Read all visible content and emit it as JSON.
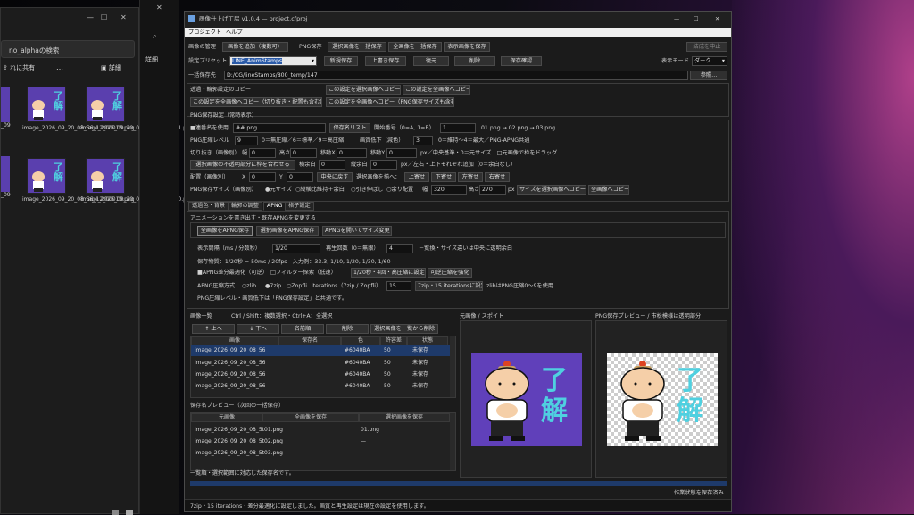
{
  "explorer": {
    "search_text": "no_alphaの検索",
    "share_label": "れに共有",
    "more_label": "…",
    "detail_label": "詳細",
    "side_label": "詳細",
    "thumbs": [
      {
        "cap": "image_2026_09_20_08_56_12_00010.png",
        "ryo": "了\n解"
      },
      {
        "cap": "image_2026_09_20_08_56_12_00011.png",
        "ryo": "了\n解"
      },
      {
        "cap": "image_2026_09_20_08_56_12_00019.png",
        "ryo": "了\n解"
      },
      {
        "cap": "image_2026_09_20_08_56_12_00020.png",
        "ryo": "了\n解"
      }
    ],
    "partial_caps": [
      "_09",
      "_56_12_0",
      "_09",
      "_56_12_0"
    ]
  },
  "app": {
    "title": "画像仕上げ工房 v1.0.4 — project.cfproj",
    "min": "—",
    "max": "☐",
    "close": "✕",
    "menu": [
      "プロジェクト",
      "ヘルプ"
    ],
    "toolbar": {
      "manage": "画像の管理",
      "add": "画像を追加（複数可）",
      "png_save": "PNG保存",
      "save_selected": "選択画像を一括保存",
      "save_all": "全画像を一括保存",
      "save_shown": "表示画像を保存",
      "stop": "結成を中止"
    },
    "preset": {
      "label": "設定プリセット",
      "value": "LINE_AnimStamps",
      "new": "新規保存",
      "overwrite": "上書き保存",
      "restore": "復元",
      "delete": "削除",
      "check": "保存確認",
      "mode_label": "表示モード",
      "mode_value": "ダーク"
    },
    "dest": {
      "label": "一括保存先",
      "value": "D:/CG/lineStamps/800_temp/147",
      "browse": "参照…"
    },
    "copy": {
      "label": "透過・輪郭設定のコピー",
      "to_selected": "この設定を選択画像へコピー",
      "to_all": "この設定を全画像へコピー",
      "copy_all_size": "この設定を全画像へコピー（切り抜き・配置も含む）",
      "copy_all_png": "この設定を全画像へコピー（PNG保存サイズも含む）"
    },
    "png": {
      "group": "PNG保存設定（常時表示）",
      "serial": "■連番名を使用",
      "serial_val": "##.png",
      "save_list": "保存名リスト",
      "start_label": "開始番号（0=A, 1=B）",
      "start_val": "1",
      "example": "01.png → 02.png → 03.png",
      "comp_label": "PNG圧縮レベル",
      "comp_val": "9",
      "comp_desc": "0＝無圧縮／6＝標準／9＝高圧縮",
      "reduce_label": "画質低下（減色）",
      "reduce_val": "3",
      "reduce_desc": "0＝維持～4＝最大／PNG-APNG共通",
      "crop_label": "切り抜き（画像別）",
      "w_label": "幅",
      "w_val": "0",
      "h_label": "高さ",
      "h_val": "0",
      "mx_label": "移動X",
      "mx_val": "0",
      "my_label": "移動Y",
      "my_val": "0",
      "crop_desc": "px／中央基準・0＝元サイズ　□元画像で枠をドラッグ",
      "fit_btn": "選択画像の不透明部分に枠を合わせる",
      "margin_label": "横余白",
      "margin_val": "0",
      "vmargin_label": "縦余白",
      "vmargin_val": "0",
      "margin_desc": "px／左右・上下それぞれ追加（0＝余白なし）",
      "place_label": "配置（画像別）",
      "x_label": "X",
      "x_val": "0",
      "y_label": "Y",
      "y_val": "0",
      "center_btn": "中央に戻す",
      "place_to": "選択画像を揃へ：",
      "up": "上寄せ",
      "down": "下寄せ",
      "left": "左寄せ",
      "right": "右寄せ",
      "size_label": "PNG保存サイズ（画像別）",
      "orig": "●元サイズ",
      "fit": "○縦横比維持＋余白",
      "stretch": "○引き伸ばし",
      "fixed": "○余り配置",
      "wl": "幅",
      "wv": "320",
      "hl": "高さ",
      "hv": "270",
      "px": "px",
      "size_to_sel": "サイズを選択画像へコピー",
      "to_all": "全画像へコピー"
    },
    "tabs": [
      "透過色・背景",
      "輪郭の調整",
      "APNG",
      "格子設定"
    ],
    "apng": {
      "header": "アニメーションを書き出す・既存APNGを変更する",
      "save_all": "全画像をAPNG保存",
      "save_sel": "選択画像をAPNG保存",
      "open": "APNGを開いてサイズ変更",
      "interval_label": "表示間隔（ms / 分数秒）",
      "interval_val": "1/20",
      "loop_label": "再生回数（0＝無限）",
      "loop_val": "4",
      "loop_desc": "－覧換・サイズ違いは中央に透明余白",
      "info1": "保存物質：1/20秒 = 50ms / 20fps　入力例：33.3, 1/10, 1/20, 1/30, 1/60",
      "opt": "■APNG差分最適化（可逆）　□フィルター探索（低速）",
      "opt_btn": "1/20秒・4回・高圧縮に設定",
      "opt_btn2": "可逆圧縮を強化",
      "method_label": "APNG圧縮方式",
      "m1": "○zlib",
      "m2": "●7zip",
      "m3": "○Zopfli",
      "iter_label": "iterations（7zip / Zopfli）",
      "iter_val": "15",
      "iter_btn": "7zip・15 iterationsに設定",
      "iter_desc": "zlibはPNG圧縮0〜9を使用",
      "note": "PNG圧縮レベル・画質低下は「PNG保存設定」と共通です。"
    },
    "list": {
      "title": "画像一覧",
      "hint": "Ctrl / Shift：複数選択・Ctrl+A：全選択",
      "up": "↑ 上へ",
      "down": "↓ 下へ",
      "rename": "名前順",
      "remove": "削除",
      "remove_sel": "選択画像を一覧から削除",
      "cols": [
        "画像",
        "保存名",
        "色",
        "許容差",
        "状態"
      ],
      "rows": [
        {
          "img": "image_2026_09_20_08_56",
          "name": "",
          "color": "#6040BA",
          "tol": "50",
          "state": "未保存"
        },
        {
          "img": "image_2026_09_20_08_56",
          "name": "",
          "color": "#6040BA",
          "tol": "50",
          "state": "未保存"
        },
        {
          "img": "image_2026_09_20_08_56",
          "name": "",
          "color": "#6040BA",
          "tol": "50",
          "state": "未保存"
        },
        {
          "img": "image_2026_09_20_08_56",
          "name": "",
          "color": "#6040BA",
          "tol": "50",
          "state": "未保存"
        }
      ]
    },
    "savepv": {
      "title": "保存名プレビュー（次回の一括保存）",
      "cols": [
        "元画像",
        "全画像を保存",
        "選択画像を保存"
      ],
      "rows": [
        {
          "src": "image_2026_09_20_08_5t01.png",
          "all": "",
          "sel": "01.png"
        },
        {
          "src": "image_2026_09_20_08_5t02.png",
          "all": "",
          "sel": "—"
        },
        {
          "src": "image_2026_09_20_08_5t03.png",
          "all": "",
          "sel": "—"
        }
      ],
      "note": "一覧順・選択範囲に対応した保存名です。"
    },
    "preview_orig": {
      "title": "元画像 / スポイト",
      "ryo": "了\n解"
    },
    "preview_png": {
      "title": "PNG保存プレビュー / 市松模様は透明部分",
      "ryo": "了\n解"
    },
    "status_right": "作業状態を保存済み",
    "status_bottom": "7zip・15 iterations・差分最適化に設定しました。画質と再生設定は現在の設定を使用します。"
  },
  "colors": {
    "accent": "#1e3a6a",
    "thumb_bg": "#5a3fae",
    "ryo": "#4fd0e0"
  }
}
